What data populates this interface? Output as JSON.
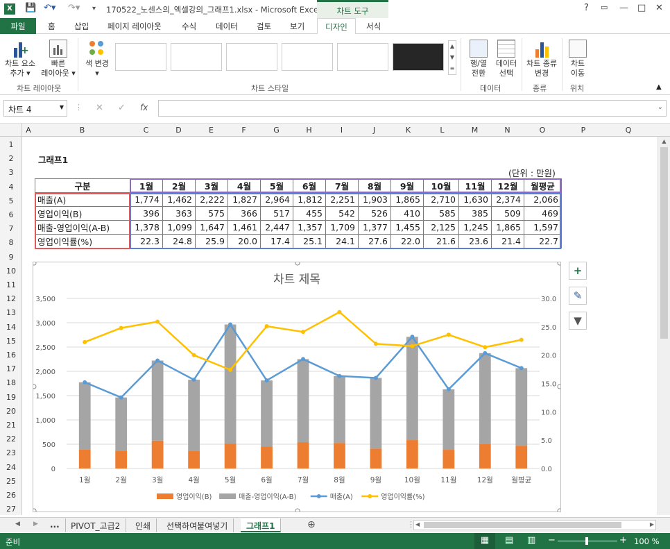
{
  "window": {
    "title": "170522_노센스의_엑셀강의_그래프1.xlsx - Microsoft Excel",
    "context_tab": "차트 도구",
    "help": "?",
    "minimize": "—",
    "restore": "□",
    "close": "✕"
  },
  "tabs": {
    "file": "파일",
    "items": [
      "홈",
      "삽입",
      "페이지 레이아웃",
      "수식",
      "데이터",
      "검토",
      "보기"
    ],
    "design": "디자인",
    "format": "서식"
  },
  "ribbon": {
    "add_element": [
      "차트 요소",
      "추가 ▾"
    ],
    "quick_layout": [
      "빠른",
      "레이아웃 ▾"
    ],
    "change_colors": [
      "색 변경",
      "▾"
    ],
    "switch_rowcol": [
      "행/열",
      "전환"
    ],
    "select_data": [
      "데이터",
      "선택"
    ],
    "change_type": [
      "차트 종류",
      "변경"
    ],
    "move_chart": [
      "차트",
      "이동"
    ],
    "groups": {
      "layouts": "차트 레이아웃",
      "styles": "차트 스타일",
      "data": "데이터",
      "type": "종류",
      "location": "위치"
    }
  },
  "formula_bar": {
    "name_box": "차트 4",
    "cancel": "✕",
    "enter": "✓",
    "fx": "fx",
    "value": ""
  },
  "columns": [
    "A",
    "B",
    "C",
    "D",
    "E",
    "F",
    "G",
    "H",
    "I",
    "J",
    "K",
    "L",
    "M",
    "N",
    "O",
    "P",
    "Q"
  ],
  "rows": [
    "1",
    "2",
    "3",
    "4",
    "5",
    "6",
    "7",
    "8",
    "9",
    "10",
    "11",
    "12",
    "13",
    "14",
    "15",
    "16",
    "17",
    "18",
    "19",
    "20",
    "21",
    "22",
    "23",
    "24",
    "25",
    "26",
    "27"
  ],
  "sheet": {
    "title": "그래프1",
    "unit": "(단위 : 만원)",
    "header": [
      "구분",
      "1월",
      "2월",
      "3월",
      "4월",
      "5월",
      "6월",
      "7월",
      "8월",
      "9월",
      "10월",
      "11월",
      "12월",
      "월평균"
    ],
    "rows": [
      {
        "label": "매출(A)",
        "values": [
          "1,774",
          "1,462",
          "2,222",
          "1,827",
          "2,964",
          "1,812",
          "2,251",
          "1,903",
          "1,865",
          "2,710",
          "1,630",
          "2,374",
          "2,066"
        ]
      },
      {
        "label": "영업이익(B)",
        "values": [
          "396",
          "363",
          "575",
          "366",
          "517",
          "455",
          "542",
          "526",
          "410",
          "585",
          "385",
          "509",
          "469"
        ]
      },
      {
        "label": "매출-영업이익(A-B)",
        "values": [
          "1,378",
          "1,099",
          "1,647",
          "1,461",
          "2,447",
          "1,357",
          "1,709",
          "1,377",
          "1,455",
          "2,125",
          "1,245",
          "1,865",
          "1,597"
        ]
      },
      {
        "label": "영업이익률(%)",
        "values": [
          "22.3",
          "24.8",
          "25.9",
          "20.0",
          "17.4",
          "25.1",
          "24.1",
          "27.6",
          "22.0",
          "21.6",
          "23.6",
          "21.4",
          "22.7"
        ]
      }
    ]
  },
  "chart_data": {
    "type": "bar",
    "title": "차트 제목",
    "categories": [
      "1월",
      "2월",
      "3월",
      "4월",
      "5월",
      "6월",
      "7월",
      "8월",
      "9월",
      "10월",
      "11월",
      "12월",
      "월평균"
    ],
    "stacked": true,
    "y_left": {
      "min": 0,
      "max": 3500,
      "step": 500,
      "ticks": [
        "0",
        "500",
        "1,000",
        "1,500",
        "2,000",
        "2,500",
        "3,000",
        "3,500"
      ]
    },
    "y_right": {
      "min": 0,
      "max": 30,
      "step": 5,
      "ticks": [
        "0.0",
        "5.0",
        "10.0",
        "15.0",
        "20.0",
        "25.0",
        "30.0"
      ]
    },
    "grid": true,
    "legend_position": "bottom",
    "series": [
      {
        "name": "영업이익(B)",
        "type": "bar",
        "axis": "left",
        "color": "#ed7d31",
        "values": [
          396,
          363,
          575,
          366,
          517,
          455,
          542,
          526,
          410,
          585,
          385,
          509,
          469
        ]
      },
      {
        "name": "매출-영업이익(A-B)",
        "type": "bar",
        "axis": "left",
        "color": "#a5a5a5",
        "values": [
          1378,
          1099,
          1647,
          1461,
          2447,
          1357,
          1709,
          1377,
          1455,
          2125,
          1245,
          1865,
          1597
        ]
      },
      {
        "name": "매출(A)",
        "type": "line",
        "axis": "left",
        "color": "#5b9bd5",
        "values": [
          1774,
          1462,
          2222,
          1827,
          2964,
          1812,
          2251,
          1903,
          1865,
          2710,
          1630,
          2374,
          2066
        ]
      },
      {
        "name": "영업이익률(%)",
        "type": "line",
        "axis": "right",
        "color": "#ffc000",
        "values": [
          22.3,
          24.8,
          25.9,
          20.0,
          17.4,
          25.1,
          24.1,
          27.6,
          22.0,
          21.6,
          23.6,
          21.4,
          22.7
        ]
      }
    ]
  },
  "sheet_tabs": {
    "more": "...",
    "items": [
      "PIVOT_고급2",
      "인쇄",
      "선택하여붙여넣기",
      "그래프1"
    ],
    "active": "그래프1",
    "add": "⊕"
  },
  "status": {
    "ready": "준비",
    "zoom": "100 %"
  }
}
